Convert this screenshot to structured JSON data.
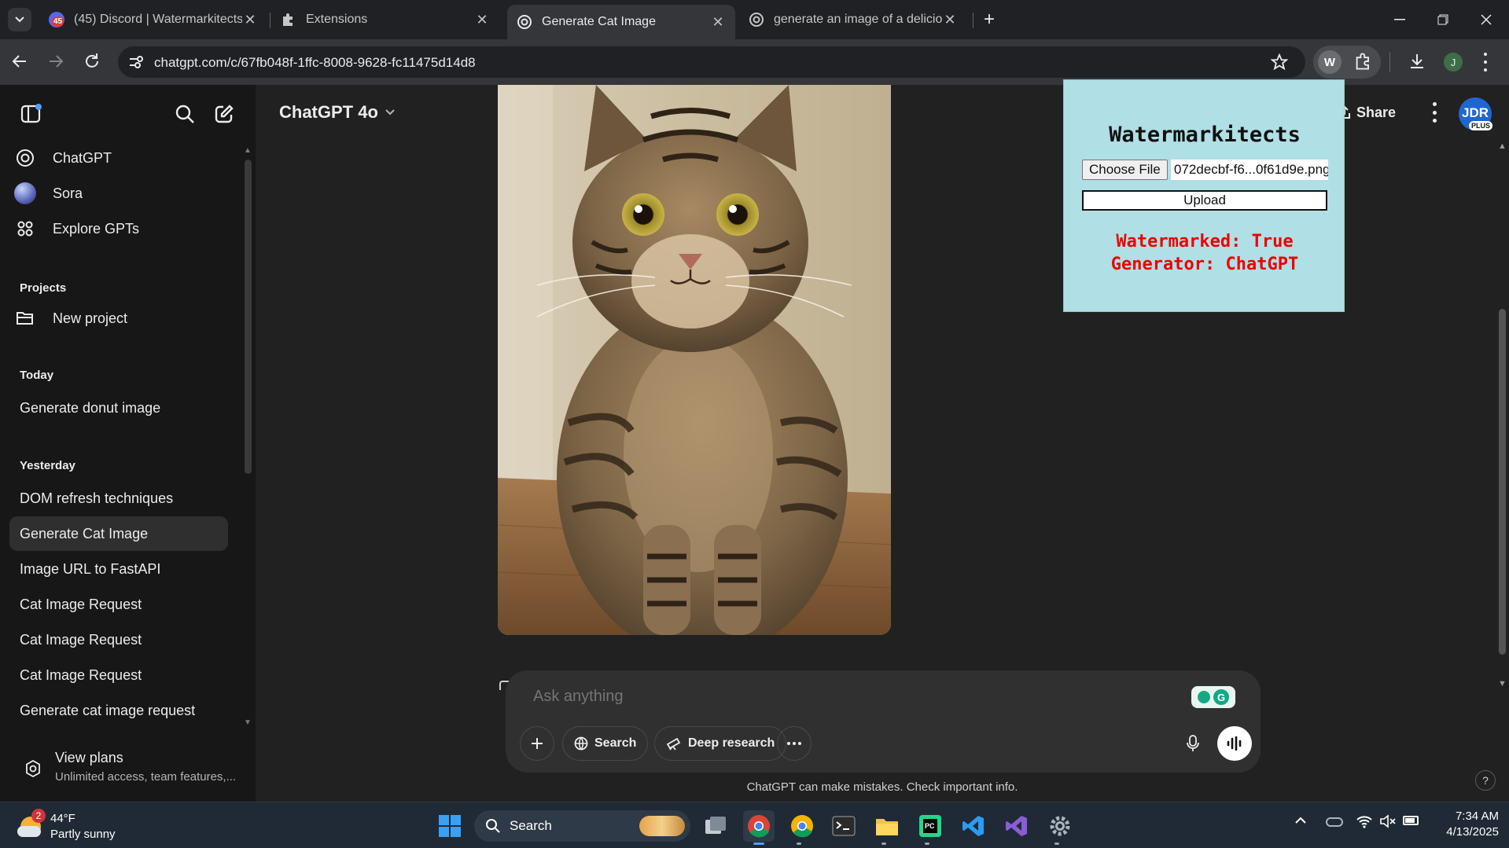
{
  "browser": {
    "tabs": [
      {
        "title": "(45) Discord | Watermarkitects",
        "badge": "45",
        "active": false
      },
      {
        "title": "Extensions",
        "active": false
      },
      {
        "title": "Generate Cat Image",
        "active": true
      },
      {
        "title": "generate an image of a deliciou",
        "active": false
      }
    ],
    "url": "chatgpt.com/c/67fb048f-1ffc-8008-9628-fc11475d14d8",
    "profile_initial": "J",
    "extension_initial": "W"
  },
  "sidebar": {
    "top_items": [
      {
        "label": "ChatGPT",
        "icon": "openai-logo-icon"
      },
      {
        "label": "Sora",
        "icon": "sora-orb-icon"
      },
      {
        "label": "Explore GPTs",
        "icon": "grid-icon"
      }
    ],
    "projects_label": "Projects",
    "new_project_label": "New project",
    "today_label": "Today",
    "today_items": [
      "Generate donut image"
    ],
    "yesterday_label": "Yesterday",
    "yesterday_items": [
      "DOM refresh techniques",
      "Generate Cat Image",
      "Image URL to FastAPI",
      "Cat Image Request",
      "Cat Image Request",
      "Cat Image Request",
      "Generate cat image request"
    ],
    "active_item": "Generate Cat Image",
    "view_plans": {
      "title": "View plans",
      "subtitle": "Unlimited access, team features,..."
    }
  },
  "header": {
    "model": "ChatGPT 4o",
    "share_label": "Share",
    "avatar": {
      "initials": "JDR",
      "badge": "PLUS"
    }
  },
  "composer": {
    "placeholder": "Ask anything",
    "search_label": "Search",
    "deep_research_label": "Deep research"
  },
  "disclaimer": "ChatGPT can make mistakes. Check important info.",
  "extension_popup": {
    "title": "Watermarkitects",
    "choose_file_label": "Choose File",
    "file_name": "072decbf-f6...0f61d9e.png",
    "upload_label": "Upload",
    "result_line1": "Watermarked: True",
    "result_line2": "Generator: ChatGPT"
  },
  "taskbar": {
    "weather_temp": "44°F",
    "weather_desc": "Partly sunny",
    "weather_badge": "2",
    "search_label": "Search",
    "time": "7:34 AM",
    "date": "4/13/2025"
  },
  "colors": {
    "sidebar_bg": "#171717",
    "main_bg": "#212121",
    "popup_bg": "#b0dfe5",
    "popup_result": "#ee0000"
  }
}
